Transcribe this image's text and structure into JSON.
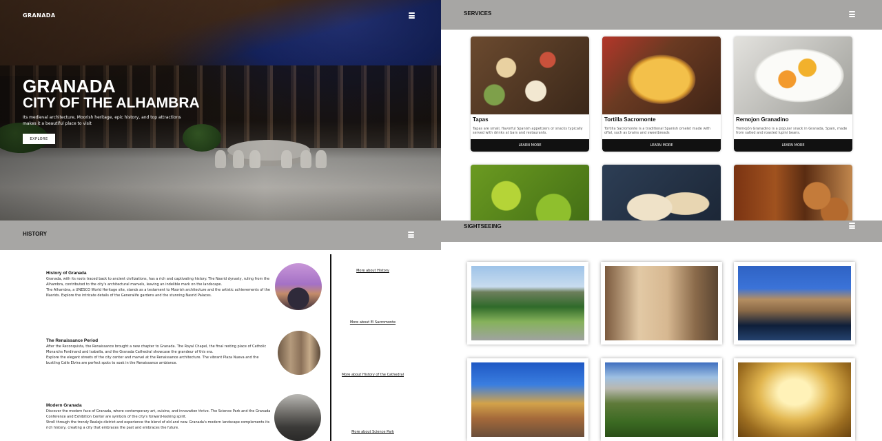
{
  "hero": {
    "brand": "GRANADA",
    "title_line1": "GRANADA",
    "title_line2": "CITY OF THE ALHAMBRA",
    "subtitle": "Its medieval architecture, Moorish heritage, epic history, and top attractions makes it a beautiful place to visit",
    "cta": "EXPLORE"
  },
  "services": {
    "title": "SERVICES",
    "cards": [
      {
        "name": "Tapas",
        "desc": "Tapas are small, flavorful Spanish appetizers or snacks typically served with drinks at bars and restaurants.",
        "button": "LEARN MORE"
      },
      {
        "name": "Tortilla Sacromonte",
        "desc": "Tortilla Sacromonte is a traditional Spanish omelet made with offal, such as brains and sweetbreads",
        "button": "LEARN MORE"
      },
      {
        "name": "Remojon Granadino",
        "desc": "Tremojón Granadino is a popular snack in Granada, Spain, made from salted and roasted lupini beans.",
        "button": "LEARN MORE"
      }
    ]
  },
  "history": {
    "title": "HISTORY",
    "items": [
      {
        "heading": "History of Granada",
        "body": "Granada, with its roots traced back to ancient civilizations, has a rich and captivating history. The Nasrid dynasty, ruling from the Alhambra, contributed to the city's architectural marvels, leaving an indelible mark on the landscape.\nThe Alhambra, a UNESCO World Heritage site, stands as a testament to Moorish architecture and the artistic achievements of the Nasrids. Explore the intricate details of the Generalife gardens and the stunning Nasrid Palaces."
      },
      {
        "heading": "The Renaissance Period",
        "body": "After the Reconquista, the Renaissance brought a new chapter to Granada. The Royal Chapel, the final resting place of Catholic Monarchs Ferdinand and Isabella, and the Granada Cathedral showcase the grandeur of this era.\nExplore the elegant streets of the city center and marvel at the Renaissance architecture. The vibrant Plaza Nueva and the bustling Calle Elvira are perfect spots to soak in the Renaissance ambiance."
      },
      {
        "heading": "Modern Granada",
        "body": "Discover the modern face of Granada, where contemporary art, cuisine, and innovation thrive. The Science Park and the Granada Conference and Exhibition Center are symbols of the city's forward-looking spirit.\nStroll through the trendy Realejo district and experience the blend of old and new. Granada's modern landscape complements its rich history, creating a city that embraces the past and embraces the future."
      }
    ],
    "links": [
      "More about History",
      "More about El Sacromonte",
      "More about History of the Cathedral",
      "More about Science Park"
    ]
  },
  "sightseeing": {
    "title": "SIGHTSEEING"
  }
}
